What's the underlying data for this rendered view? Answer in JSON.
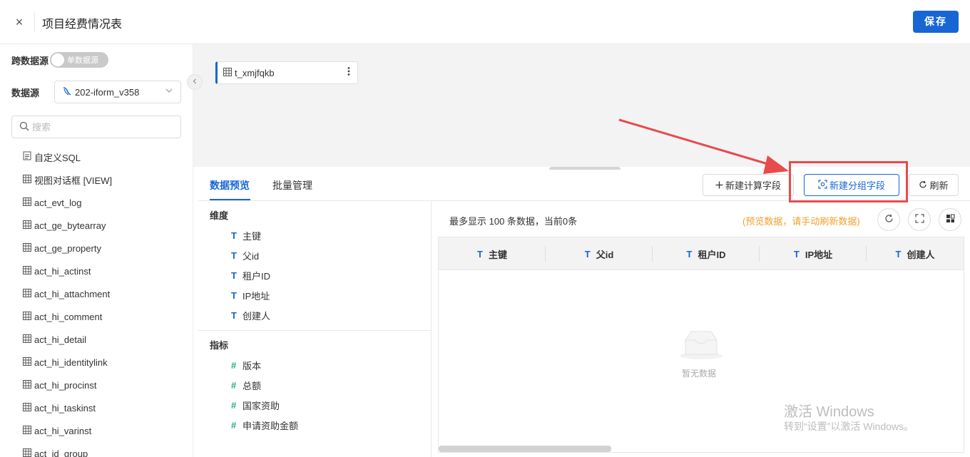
{
  "header": {
    "close_icon": "×",
    "title": "项目经费情况表",
    "save_label": "保存"
  },
  "sidebar": {
    "cross_source_label": "跨数据源",
    "toggle_label": "单数据源",
    "datasource_label": "数据源",
    "datasource_value": "202-iform_v358",
    "search_placeholder": "搜索",
    "items": [
      {
        "icon": "sql-icon",
        "label": "自定义SQL"
      },
      {
        "icon": "table-icon",
        "label": "视图对话框 [VIEW]"
      },
      {
        "icon": "table-icon",
        "label": "act_evt_log"
      },
      {
        "icon": "table-icon",
        "label": "act_ge_bytearray"
      },
      {
        "icon": "table-icon",
        "label": "act_ge_property"
      },
      {
        "icon": "table-icon",
        "label": "act_hi_actinst"
      },
      {
        "icon": "table-icon",
        "label": "act_hi_attachment"
      },
      {
        "icon": "table-icon",
        "label": "act_hi_comment"
      },
      {
        "icon": "table-icon",
        "label": "act_hi_detail"
      },
      {
        "icon": "table-icon",
        "label": "act_hi_identitylink"
      },
      {
        "icon": "table-icon",
        "label": "act_hi_procinst"
      },
      {
        "icon": "table-icon",
        "label": "act_hi_taskinst"
      },
      {
        "icon": "table-icon",
        "label": "act_hi_varinst"
      },
      {
        "icon": "table-icon",
        "label": "act_id_group"
      }
    ]
  },
  "canvas": {
    "node_name": "t_xmjfqkb"
  },
  "panel": {
    "tabs": [
      "数据预览",
      "批量管理"
    ],
    "new_calc_field": "新建计算字段",
    "new_group_field": "新建分组字段",
    "refresh": "刷新",
    "dimension_title": "维度",
    "dimensions": [
      "主键",
      "父id",
      "租户ID",
      "IP地址",
      "创建人"
    ],
    "measure_title": "指标",
    "measures": [
      "版本",
      "总额",
      "国家资助",
      "申请资助金额"
    ],
    "max_text": "最多显示 100 条数据，当前0条",
    "hint_text": "(预览数据，请手动刷新数据)",
    "columns": [
      "主键",
      "父id",
      "租户ID",
      "IP地址",
      "创建人"
    ],
    "empty_text": "暂无数据"
  },
  "watermark": {
    "line1": "激活 Windows",
    "line2": "转到“设置”以激活 Windows。"
  },
  "colors": {
    "primary": "#1766d3",
    "annotation": "#e84b4b",
    "hint": "#f0a030",
    "measure": "#27b07a"
  }
}
